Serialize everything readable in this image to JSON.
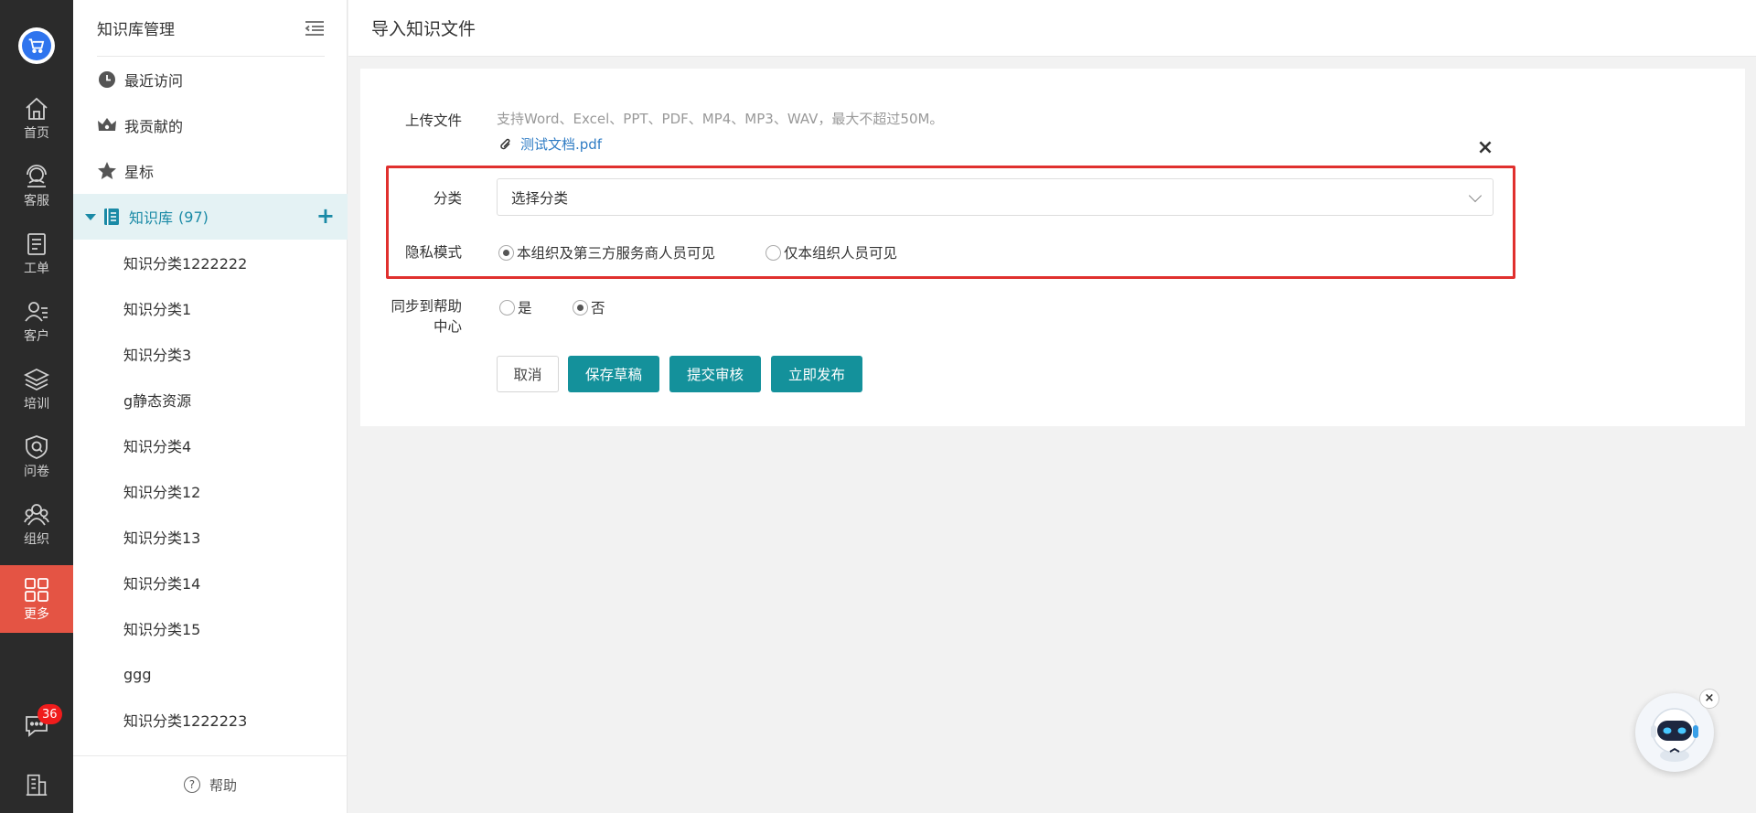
{
  "rail": {
    "items": [
      {
        "label": "首页",
        "icon": "home-icon"
      },
      {
        "label": "客服",
        "icon": "customer-service-icon"
      },
      {
        "label": "工单",
        "icon": "ticket-icon"
      },
      {
        "label": "客户",
        "icon": "customer-icon"
      },
      {
        "label": "培训",
        "icon": "training-icon"
      },
      {
        "label": "问卷",
        "icon": "survey-icon"
      },
      {
        "label": "组织",
        "icon": "organization-icon"
      },
      {
        "label": "更多",
        "icon": "more-grid-icon",
        "active": true
      }
    ],
    "chat_badge": "36",
    "active_color": "#e45444"
  },
  "sidebar": {
    "title": "知识库管理",
    "nav": [
      {
        "label": "最近访问",
        "icon": "clock-icon"
      },
      {
        "label": "我贡献的",
        "icon": "crown-icon"
      },
      {
        "label": "星标",
        "icon": "star-icon"
      }
    ],
    "knowledge_base": {
      "label": "知识库",
      "count": "(97)"
    },
    "categories": [
      "知识分类1222222",
      "知识分类1",
      "知识分类3",
      "g静态资源",
      "知识分类4",
      "知识分类12",
      "知识分类13",
      "知识分类14",
      "知识分类15",
      "ggg",
      "知识分类1222223"
    ],
    "help": "帮助"
  },
  "main": {
    "title": "导入知识文件",
    "form": {
      "upload_label": "上传文件",
      "upload_hint": "支持Word、Excel、PPT、PDF、MP4、MP3、WAV，最大不超过50M。",
      "file_name": "测试文档.pdf",
      "category_label": "分类",
      "category_placeholder": "选择分类",
      "privacy_label": "隐私模式",
      "privacy_options": [
        "本组织及第三方服务商人员可见",
        "仅本组织人员可见"
      ],
      "privacy_selected": 0,
      "sync_label_line1": "同步到帮助",
      "sync_label_line2": "中心",
      "sync_options": [
        "是",
        "否"
      ],
      "sync_selected": 1,
      "buttons": {
        "cancel": "取消",
        "save_draft": "保存草稿",
        "submit_review": "提交审核",
        "publish": "立即发布"
      }
    }
  },
  "colors": {
    "primary": "#14919b",
    "highlight": "#e0302e",
    "link": "#2f7cc4"
  }
}
